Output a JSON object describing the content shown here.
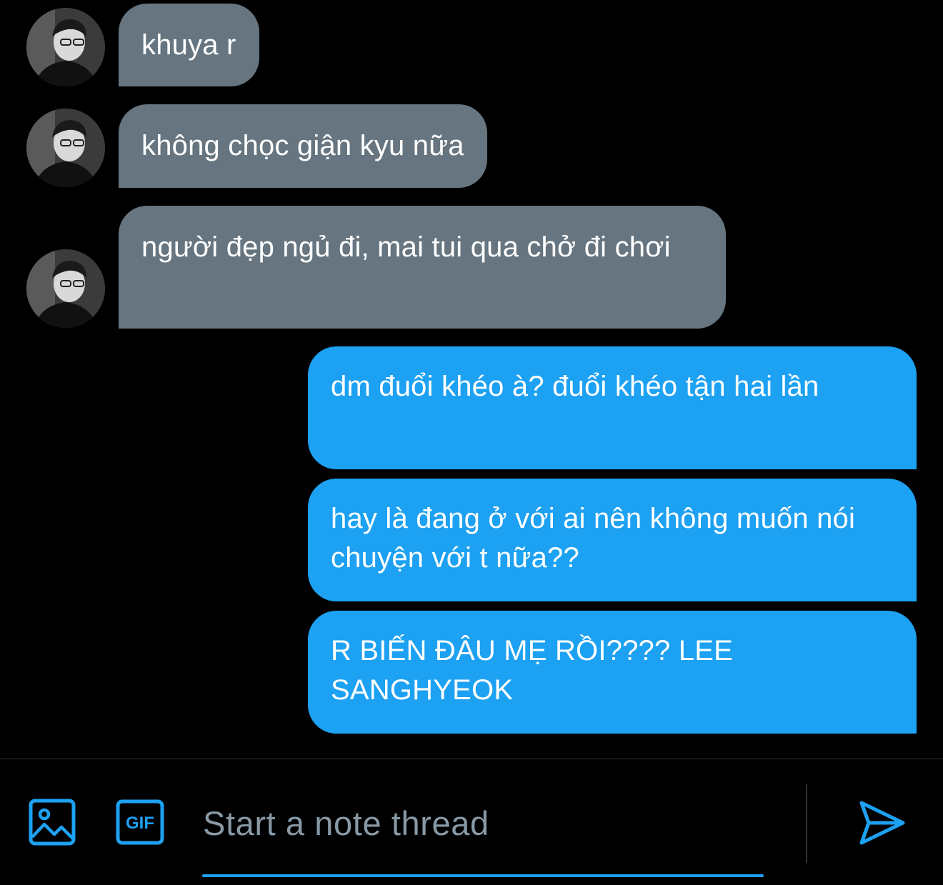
{
  "messages": [
    {
      "direction": "incoming",
      "text": "khuya r"
    },
    {
      "direction": "incoming",
      "text": "không chọc giận kyu nữa"
    },
    {
      "direction": "incoming",
      "text": "người đẹp ngủ đi, mai tui qua chở đi chơi"
    },
    {
      "direction": "outgoing",
      "text": "dm đuổi khéo à? đuổi khéo tận hai lần"
    },
    {
      "direction": "outgoing",
      "text": "hay là đang ở với ai nên không muốn nói chuyện với t nữa??"
    },
    {
      "direction": "outgoing",
      "text": "R BIẾN ĐÂU MẸ RỒI???? LEE SANGHYEOK"
    }
  ],
  "composer": {
    "placeholder": "Start a note thread",
    "media_icon": "image-icon",
    "gif_label": "GIF",
    "send_icon": "send-icon"
  },
  "colors": {
    "background": "#000000",
    "incoming_bubble": "#66757f",
    "outgoing_bubble": "#1da1f2",
    "accent": "#1da1f2",
    "placeholder": "#8899a6",
    "divider": "#2f3336"
  }
}
